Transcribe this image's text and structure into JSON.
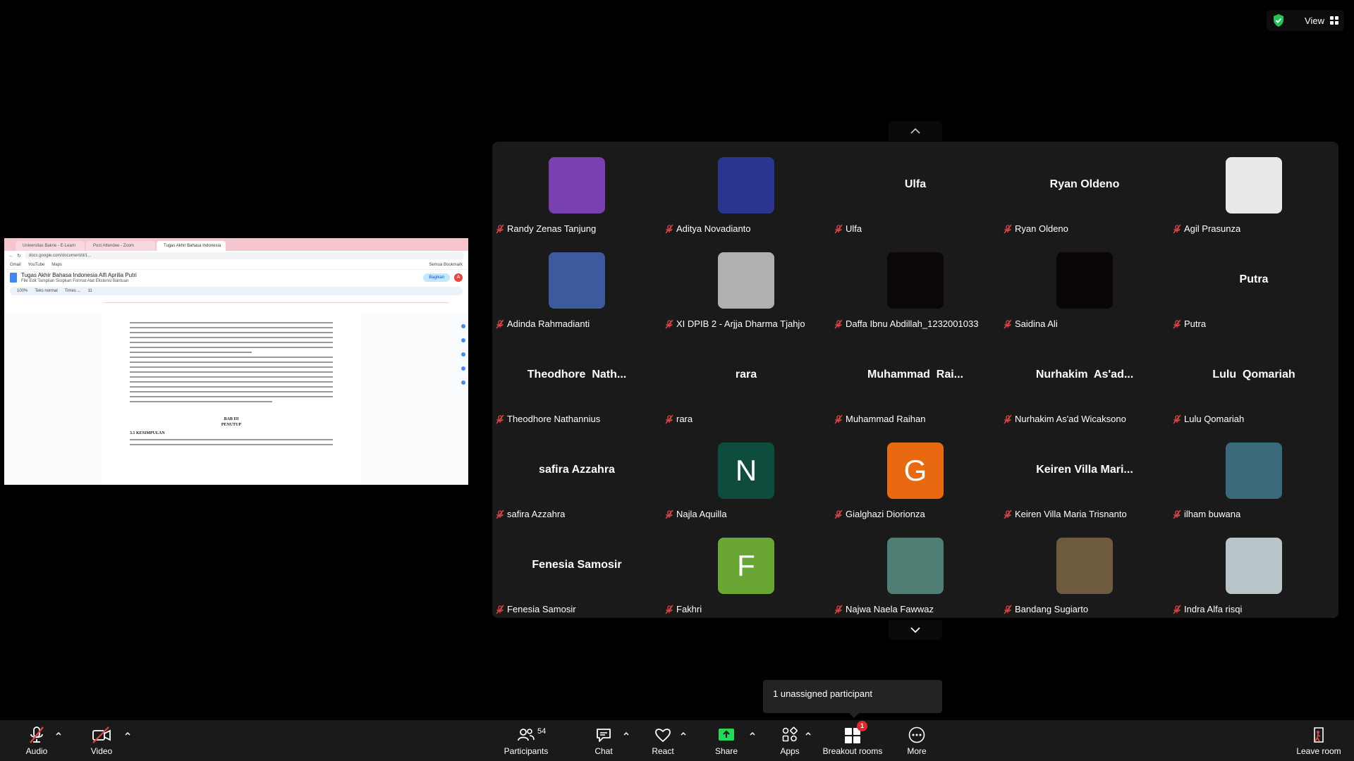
{
  "top_bar": {
    "view_label": "View"
  },
  "shared_screen": {
    "tabs": [
      "Universitas Bakrie - E-Learn",
      "Post Attendee - Zoom",
      "Tugas Akhir Bahasa Indonesia"
    ],
    "url": "docs.google.com/document/d/1...",
    "bookmarks": [
      "Gmail",
      "YouTube",
      "Maps"
    ],
    "bookmarks_right": "Semua Bookmark",
    "doc_title": "Tugas Akhir Bahasa Indonesia Alfi Aprilia Putri",
    "doc_menus": "File  Edit  Tampilan  Sisipkan  Format  Alat  Ekstensi  Bantuan",
    "share_button": "Bagikan",
    "account_initial": "A",
    "toolbar_items": [
      "100%",
      "Teks normal",
      "Times ...",
      "11"
    ],
    "chapter": "BAB III",
    "chapter_title": "PENUTUP",
    "section": "3.1 KESIMPULAN"
  },
  "participants": [
    {
      "label": "Randy Zenas Tanjung",
      "tile": "image",
      "color": "#7a3fb0"
    },
    {
      "label": "Aditya Novadianto",
      "tile": "image",
      "color": "#2a3590"
    },
    {
      "label": "Ulfa",
      "tile": "name",
      "big": "Ulfa"
    },
    {
      "label": "Ryan Oldeno",
      "tile": "name",
      "big": "Ryan Oldeno"
    },
    {
      "label": "Agil Prasunza",
      "tile": "image",
      "color": "#e8e8e8"
    },
    {
      "label": "Adinda Rahmadianti",
      "tile": "image",
      "color": "#3d5a9e"
    },
    {
      "label": "XI DPIB 2 - Arjja Dharma Tjahjo",
      "tile": "image",
      "color": "#b0b0b0"
    },
    {
      "label": "Daffa Ibnu Abdillah_1232001033",
      "tile": "image",
      "color": "#0b0608"
    },
    {
      "label": "Saidina Ali",
      "tile": "image",
      "color": "#0b0606"
    },
    {
      "label": "Putra",
      "tile": "name",
      "big": "Putra"
    },
    {
      "label": "Theodhore Nathannius",
      "tile": "name",
      "big": "Theodhore  Nath..."
    },
    {
      "label": "rara",
      "tile": "name",
      "big": "rara"
    },
    {
      "label": "Muhammad Raihan",
      "tile": "name",
      "big": "Muhammad  Rai..."
    },
    {
      "label": "Nurhakim As'ad Wicaksono",
      "tile": "name",
      "big": "Nurhakim  As'ad..."
    },
    {
      "label": "Lulu  Qomariah",
      "tile": "name",
      "big": "Lulu  Qomariah"
    },
    {
      "label": "safira Azzahra",
      "tile": "name",
      "big": "safira Azzahra"
    },
    {
      "label": "Najla Aquilla",
      "tile": "letter",
      "letter": "N",
      "color": "#0e4c3e"
    },
    {
      "label": "Gialghazi Diorionza",
      "tile": "letter",
      "letter": "G",
      "color": "#e8690f"
    },
    {
      "label": "Keiren Villa Maria Trisnanto",
      "tile": "name",
      "big": "Keiren Villa Mari..."
    },
    {
      "label": "ilham buwana",
      "tile": "image",
      "color": "#3a6a7a"
    },
    {
      "label": "Fenesia Samosir",
      "tile": "name",
      "big": "Fenesia Samosir"
    },
    {
      "label": "Fakhri",
      "tile": "letter",
      "letter": "F",
      "color": "#6aa634"
    },
    {
      "label": "Najwa Naela Fawwaz",
      "tile": "image",
      "color": "#4f7e74"
    },
    {
      "label": "Bandang Sugiarto",
      "tile": "image",
      "color": "#6e5a3e"
    },
    {
      "label": "Indra Alfa risqi",
      "tile": "image",
      "color": "#b8c4c8"
    }
  ],
  "tooltip": "1 unassigned participant",
  "bottom_bar": {
    "audio": "Audio",
    "video": "Video",
    "participants": "Participants",
    "participants_count": "54",
    "chat": "Chat",
    "react": "React",
    "share": "Share",
    "apps": "Apps",
    "breakout": "Breakout rooms",
    "breakout_badge": "1",
    "more": "More",
    "leave": "Leave room"
  },
  "colors": {
    "share_green": "#23d959",
    "mute_red": "#e04646",
    "shield_green": "#23c25a",
    "badge_red": "#e02828"
  }
}
